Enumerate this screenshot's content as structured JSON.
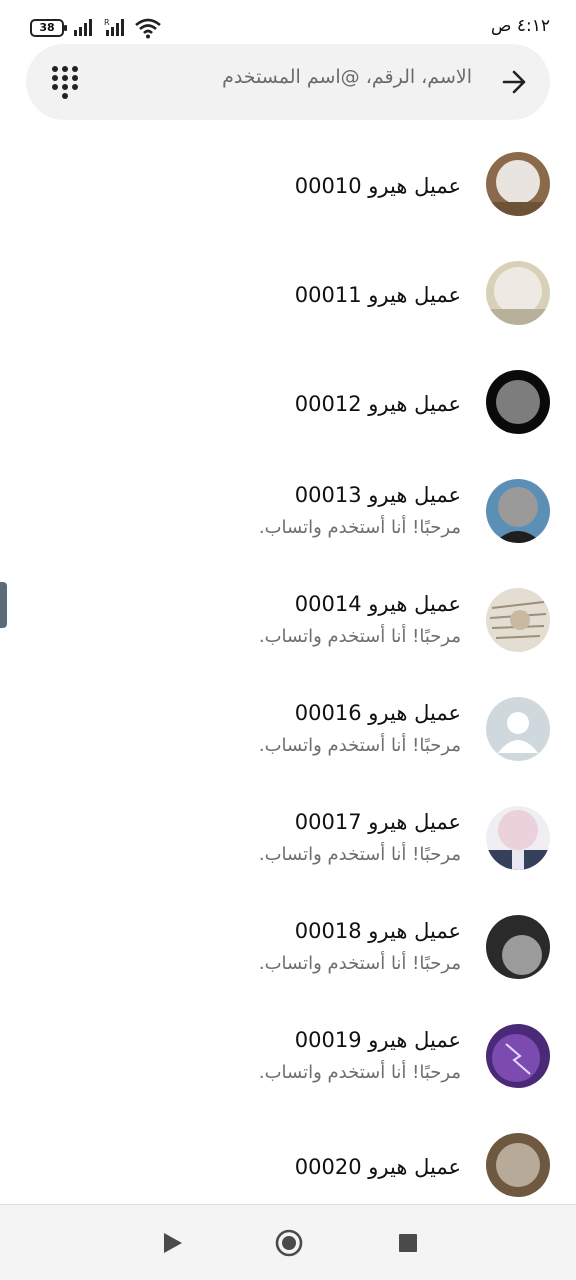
{
  "status_bar": {
    "time": "٤:١٢ ص",
    "battery": "38"
  },
  "search": {
    "placeholder": "الاسم، الرقم، @اسم المستخدم"
  },
  "contacts": [
    {
      "name": "عميل هيرو 00010",
      "status": ""
    },
    {
      "name": "عميل هيرو 00011",
      "status": ""
    },
    {
      "name": "عميل هيرو 00012",
      "status": ""
    },
    {
      "name": "عميل هيرو 00013",
      "status": "مرحبًا! أنا أستخدم واتساب."
    },
    {
      "name": "عميل هيرو 00014",
      "status": "مرحبًا! أنا أستخدم واتساب."
    },
    {
      "name": "عميل هيرو 00016",
      "status": "مرحبًا! أنا أستخدم واتساب."
    },
    {
      "name": "عميل هيرو 00017",
      "status": "مرحبًا! أنا أستخدم واتساب."
    },
    {
      "name": "عميل هيرو 00018",
      "status": "مرحبًا! أنا أستخدم واتساب."
    },
    {
      "name": "عميل هيرو 00019",
      "status": "مرحبًا! أنا أستخدم واتساب."
    },
    {
      "name": "عميل هيرو 00020",
      "status": ""
    }
  ],
  "colors": {
    "search_bg": "#f2f2f2",
    "status_text": "#6e6e6e",
    "default_avatar_bg": "#cfd8dc"
  }
}
